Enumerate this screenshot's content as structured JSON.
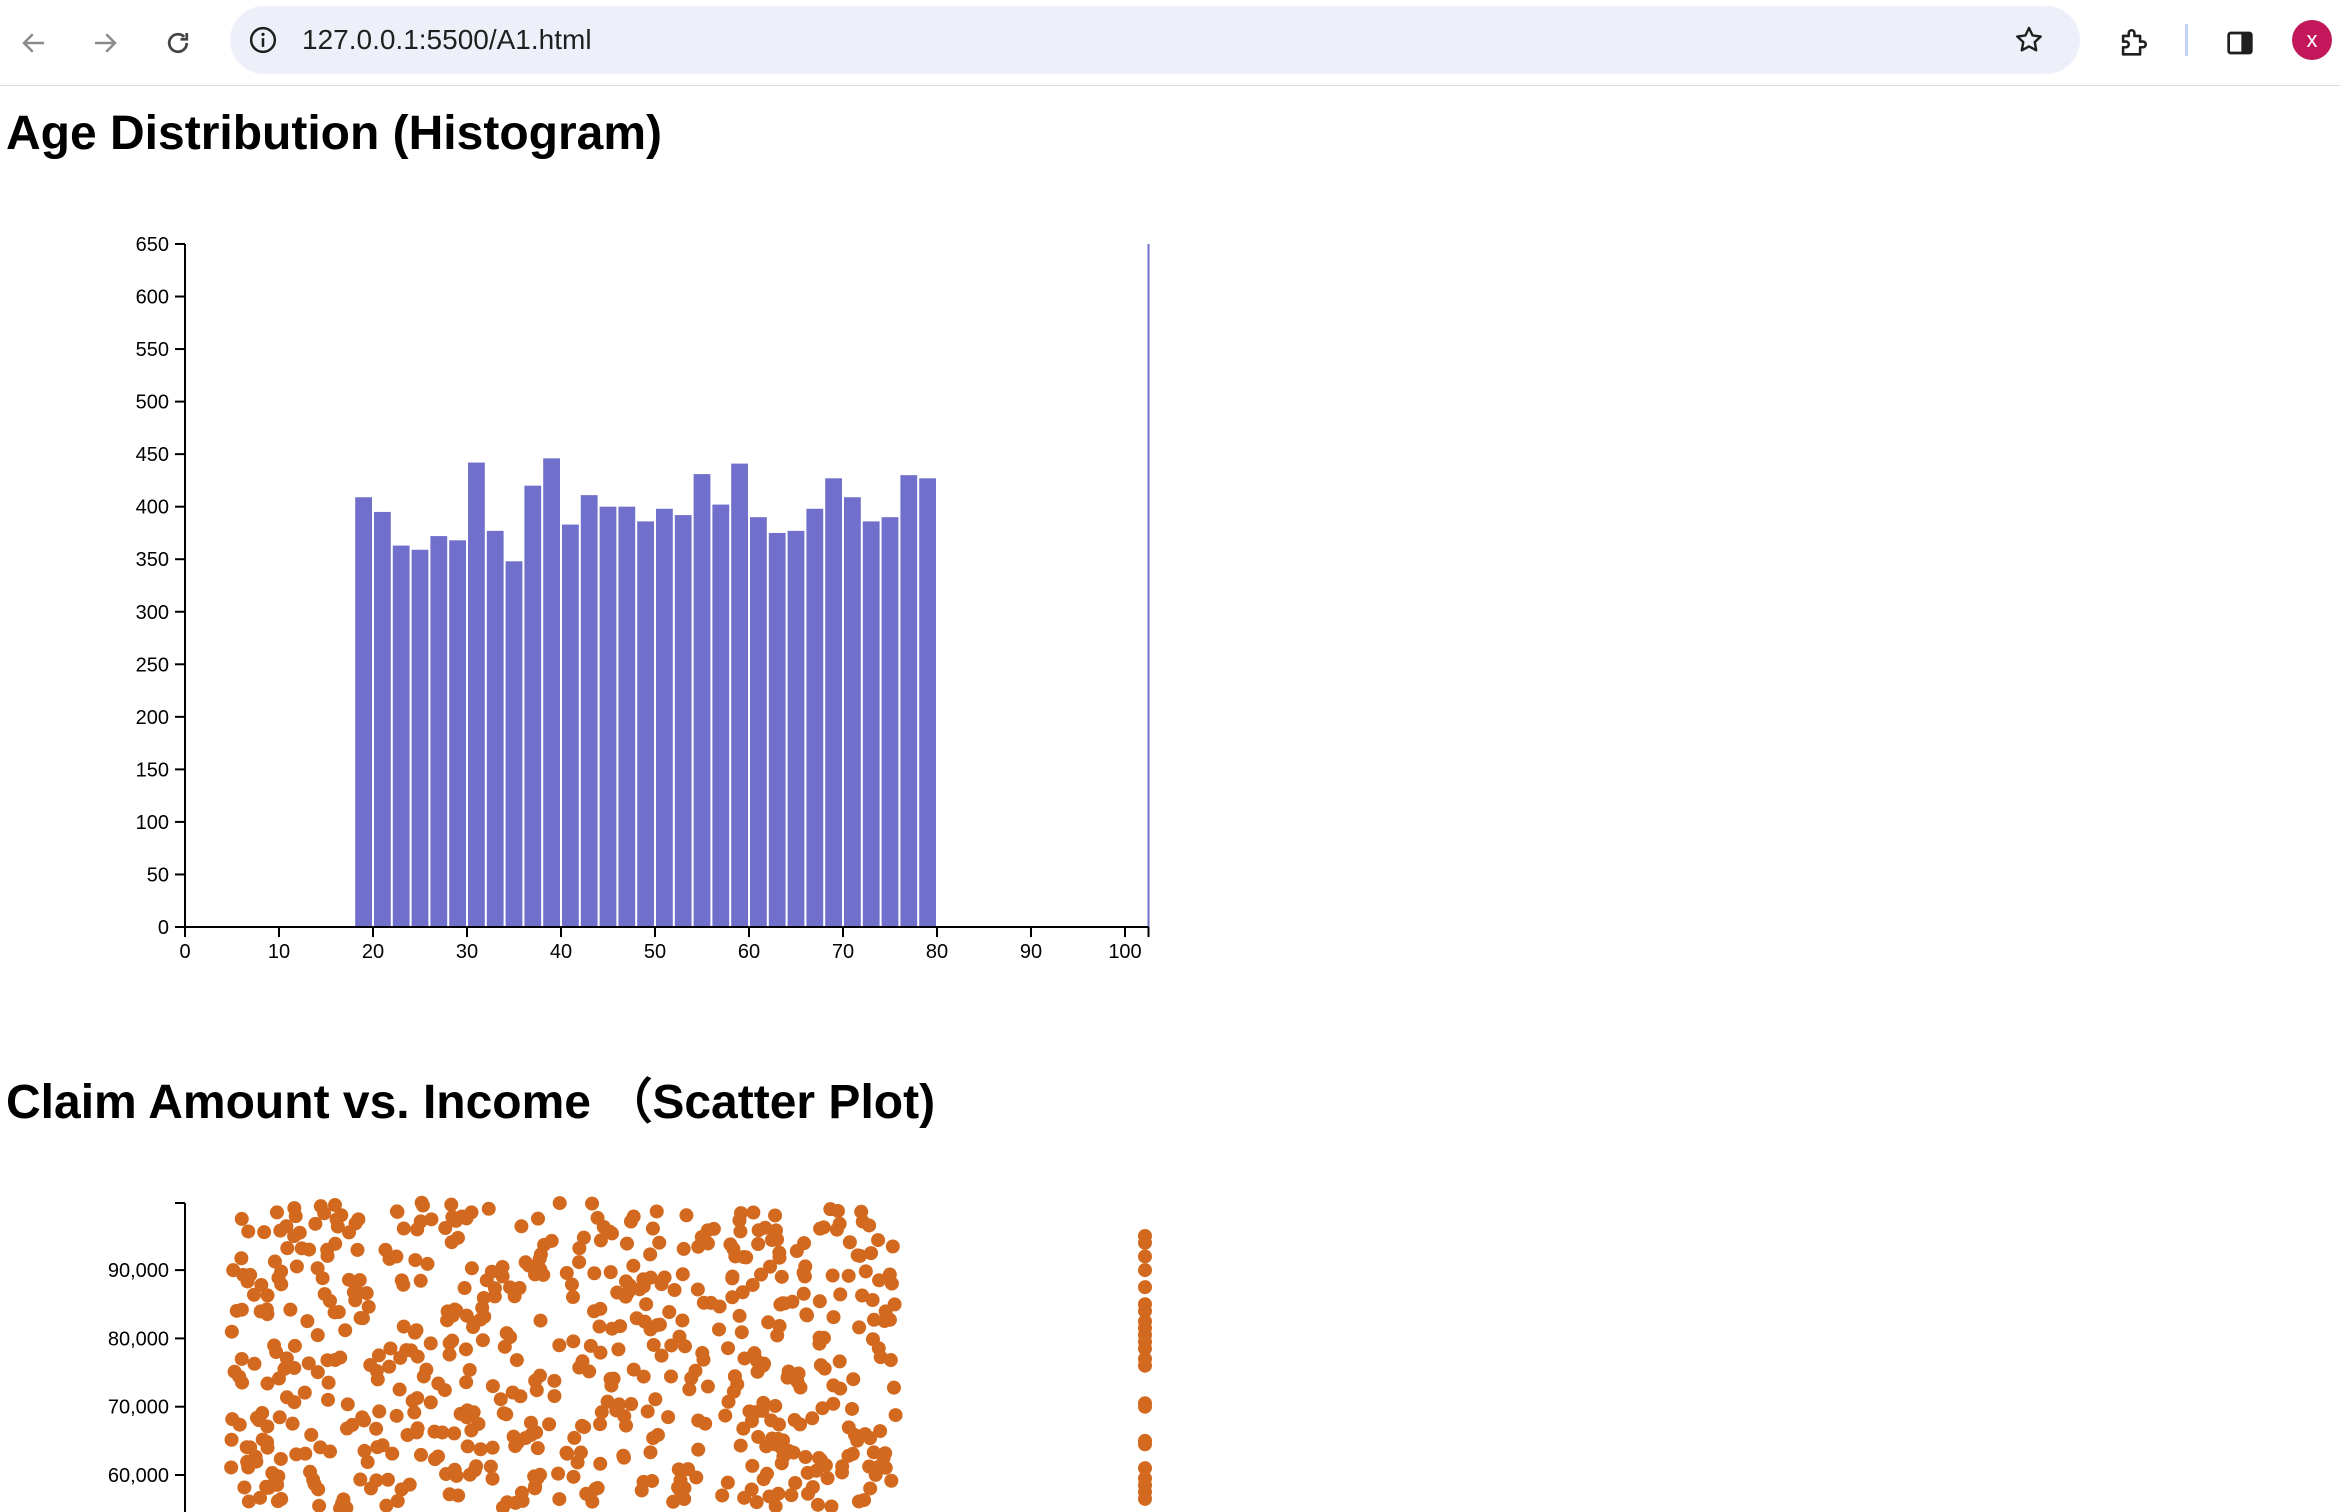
{
  "browser": {
    "url": "127.0.0.1:5500/A1.html",
    "profile_initial": "x",
    "icons": [
      "back-arrow-icon",
      "forward-arrow-icon",
      "reload-icon",
      "site-info-icon",
      "star-icon",
      "extensions-icon",
      "side-panel-icon"
    ]
  },
  "histogram": {
    "heading": "Age Distribution (Histogram)",
    "bar_color": "#7070cc"
  },
  "scatter": {
    "heading": "Claim Amount vs. Income （Scatter Plot)",
    "point_color": "#d2691e"
  },
  "chart_data": [
    {
      "type": "bar",
      "title": "",
      "xlabel": "",
      "ylabel": "",
      "x_range": [
        0,
        102.5
      ],
      "ylim": [
        0,
        650
      ],
      "x_ticks": [
        "0",
        "10",
        "20",
        "30",
        "40",
        "50",
        "60",
        "70",
        "80",
        "90",
        "100"
      ],
      "y_ticks": [
        "0",
        "50",
        "100",
        "150",
        "200",
        "250",
        "300",
        "350",
        "400",
        "450",
        "500",
        "550",
        "600",
        "650"
      ],
      "bin_width": 2,
      "bins": [
        {
          "x0": 18,
          "value": 409
        },
        {
          "x0": 20,
          "value": 395
        },
        {
          "x0": 22,
          "value": 363
        },
        {
          "x0": 24,
          "value": 359
        },
        {
          "x0": 26,
          "value": 372
        },
        {
          "x0": 28,
          "value": 368
        },
        {
          "x0": 30,
          "value": 442
        },
        {
          "x0": 32,
          "value": 377
        },
        {
          "x0": 34,
          "value": 348
        },
        {
          "x0": 36,
          "value": 420
        },
        {
          "x0": 38,
          "value": 446
        },
        {
          "x0": 40,
          "value": 383
        },
        {
          "x0": 42,
          "value": 411
        },
        {
          "x0": 44,
          "value": 400
        },
        {
          "x0": 46,
          "value": 400
        },
        {
          "x0": 48,
          "value": 386
        },
        {
          "x0": 50,
          "value": 398
        },
        {
          "x0": 52,
          "value": 392
        },
        {
          "x0": 54,
          "value": 431
        },
        {
          "x0": 56,
          "value": 402
        },
        {
          "x0": 58,
          "value": 441
        },
        {
          "x0": 60,
          "value": 390
        },
        {
          "x0": 62,
          "value": 375
        },
        {
          "x0": 64,
          "value": 377
        },
        {
          "x0": 66,
          "value": 398
        },
        {
          "x0": 68,
          "value": 427
        },
        {
          "x0": 70,
          "value": 409
        },
        {
          "x0": 72,
          "value": 386
        },
        {
          "x0": 74,
          "value": 390
        },
        {
          "x0": 76,
          "value": 430
        },
        {
          "x0": 78,
          "value": 427
        }
      ],
      "extra_bar": {
        "x": 102.5,
        "value": 650
      }
    },
    {
      "type": "scatter",
      "title": "",
      "xlabel": "",
      "ylabel": "",
      "y_ticks": [
        "60,000",
        "70,000",
        "80,000",
        "90,000"
      ],
      "y_range_visible": [
        55000,
        100000
      ],
      "x_range": [
        0,
        100
      ],
      "main_cluster": {
        "x_range": [
          5,
          75
        ],
        "y_range": [
          55000,
          100000
        ],
        "count": 620
      },
      "right_column": {
        "x": 100,
        "values": [
          95000,
          94000,
          92000,
          90000,
          87500,
          85000,
          84000,
          82500,
          81500,
          80500,
          79500,
          78500,
          77000,
          76000,
          70500,
          70000,
          65000,
          64500,
          61000,
          59500,
          58500,
          57500,
          56500
        ]
      }
    }
  ]
}
